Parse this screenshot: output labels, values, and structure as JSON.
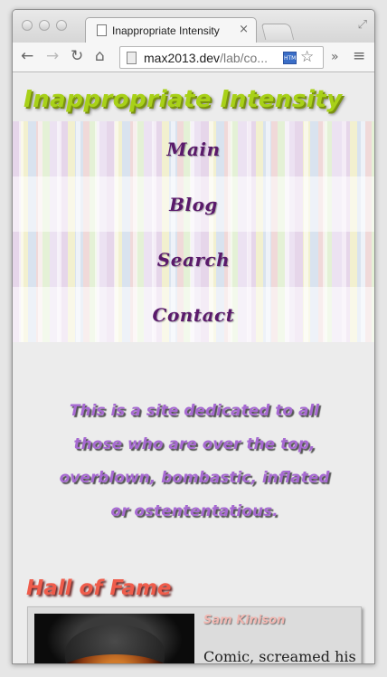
{
  "browser": {
    "tab_title": "Inappropriate Intensity",
    "tab_close": "×",
    "url_host": "max2013.dev",
    "url_rest": "/lab/co...",
    "html5_badge": "HTML",
    "overflow": "»"
  },
  "site": {
    "title": "Inappropriate Intensity",
    "nav": [
      "Main",
      "Blog",
      "Search",
      "Contact"
    ],
    "intro": "This is a site dedicated to all those who are over the top, overblown, bombastic, inflated or ostententatious.",
    "hall_of_fame": {
      "heading": "Hall of Fame",
      "entries": [
        {
          "name": "Sam Kinison",
          "description": "Comic, screamed his"
        }
      ]
    }
  },
  "colors": {
    "site_title": "#a8d118",
    "nav_text": "#5a1a6b",
    "intro_text": "#a76ad2",
    "hof_heading": "#ef5c4b"
  }
}
